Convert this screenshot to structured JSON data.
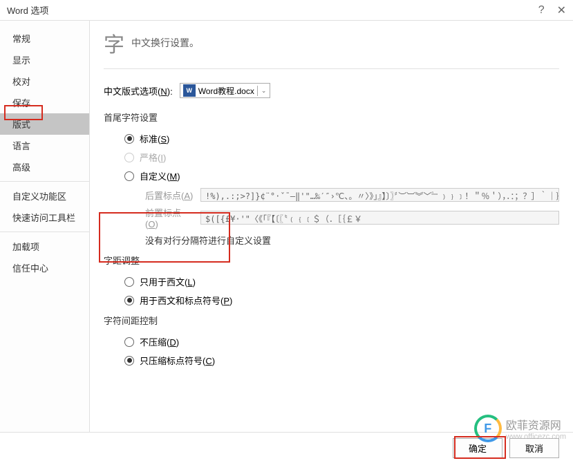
{
  "title": "Word 选项",
  "sidebar": {
    "items": [
      {
        "label": "常规"
      },
      {
        "label": "显示"
      },
      {
        "label": "校对"
      },
      {
        "label": "保存"
      },
      {
        "label": "版式",
        "selected": true
      },
      {
        "label": "语言"
      },
      {
        "label": "高级"
      },
      {
        "label": "自定义功能区",
        "divider_before": true
      },
      {
        "label": "快速访问工具栏"
      },
      {
        "label": "加载项",
        "divider_before": true
      },
      {
        "label": "信任中心"
      }
    ]
  },
  "header": {
    "icon": "字",
    "text": "中文换行设置。"
  },
  "file_row": {
    "label": "中文版式选项(N):",
    "hotkey": "N",
    "file_name": "Word教程.docx"
  },
  "sections": {
    "first_last": {
      "title": "首尾字符设置",
      "options": [
        {
          "label": "标准(S)",
          "hotkey": "S",
          "checked": true
        },
        {
          "label": "严格(I)",
          "hotkey": "I",
          "disabled": true
        },
        {
          "label": "自定义(M)",
          "hotkey": "M"
        }
      ],
      "after_label": "后置标点(A)",
      "after_hotkey": "A",
      "after_value": "!%),.:;>?]}¢¨°·ˇˉ―‖'\"…‰′″›℃、。〃〉》」』】〕〗〞︶︺︾﹀﹄﹚﹜﹞！＂％＇），．：；？］｀｜｝～￠",
      "before_label": "前置标点(O)",
      "before_hotkey": "O",
      "before_value": "$([{£¥·'\"〈《「『【〔〖〝﹙﹛﹝＄（．［｛￡￥",
      "note": "没有对行分隔符进行自定义设置"
    },
    "kerning": {
      "title": "字距调整",
      "options": [
        {
          "label": "只用于西文(L)",
          "hotkey": "L"
        },
        {
          "label": "用于西文和标点符号(P)",
          "hotkey": "P",
          "checked": true
        }
      ]
    },
    "spacing": {
      "title": "字符间距控制",
      "options": [
        {
          "label": "不压缩(D)",
          "hotkey": "D"
        },
        {
          "label": "只压缩标点符号(C)",
          "hotkey": "C",
          "checked": true
        }
      ]
    }
  },
  "buttons": {
    "ok": "确定",
    "cancel": "取消"
  },
  "watermark": {
    "brand": "欧菲资源网",
    "url": "www.officezc.com",
    "icon_letter": "F"
  }
}
